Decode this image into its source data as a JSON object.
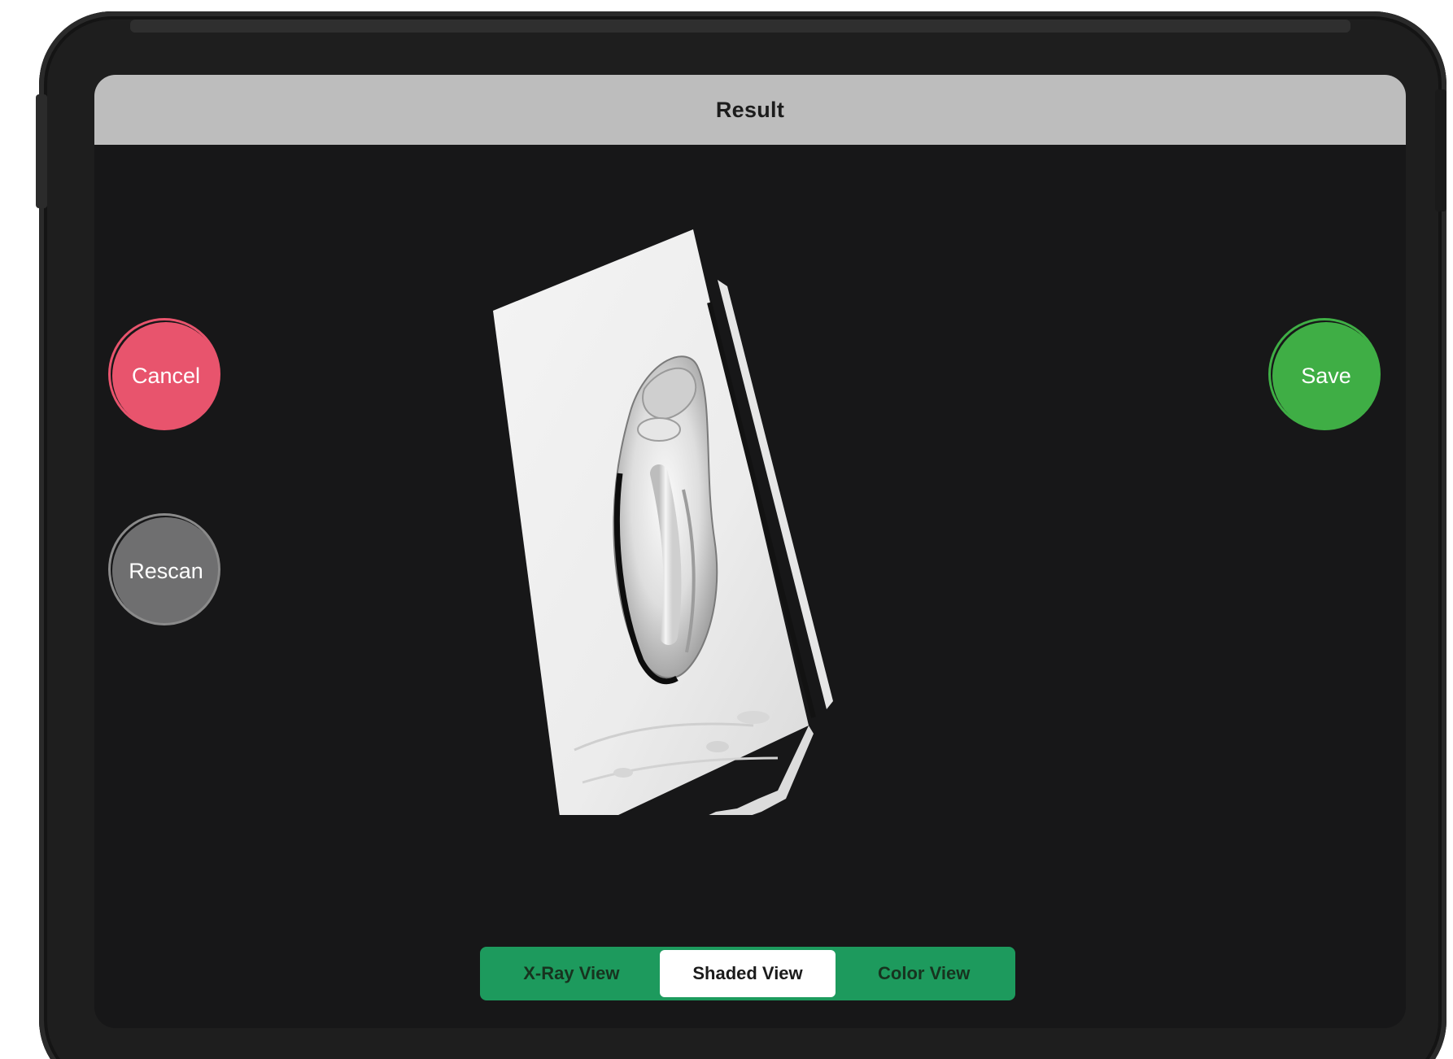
{
  "navbar": {
    "title": "Result"
  },
  "actions": {
    "cancel_label": "Cancel",
    "rescan_label": "Rescan",
    "save_label": "Save"
  },
  "view_modes": {
    "options": [
      "X-Ray View",
      "Shaded View",
      "Color View"
    ],
    "selected": "Shaded View"
  },
  "colors": {
    "cancel": "#e8546d",
    "rescan": "#6f6f70",
    "save": "#3fae45",
    "segmented_bg": "#1d9a5d",
    "navbar_bg": "#bdbdbd",
    "screen_bg": "#171718"
  }
}
